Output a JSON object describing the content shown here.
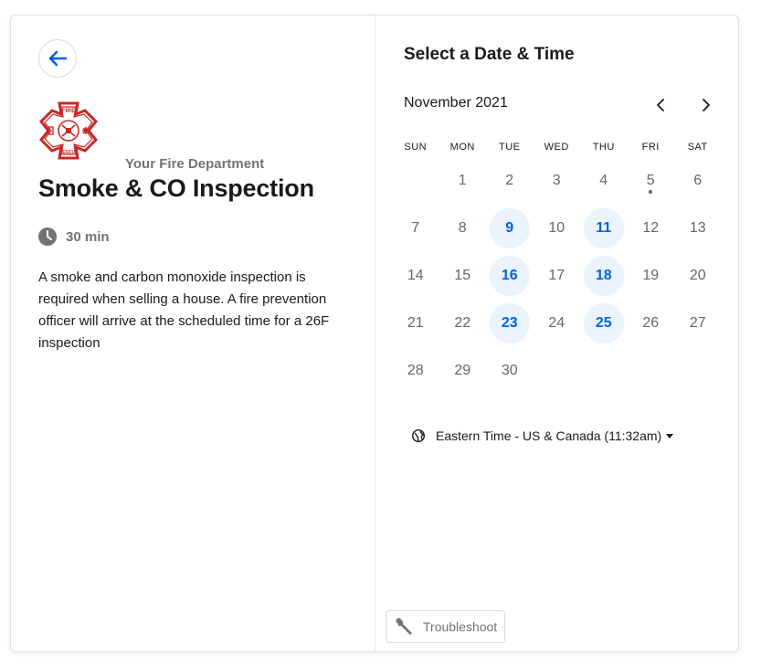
{
  "event": {
    "organization": "Your Fire Department",
    "title": "Smoke & CO Inspection",
    "duration": "30 min",
    "description": "A smoke and carbon monoxide inspection is required when selling a house. A fire prevention officer will arrive at the scheduled time for a 26F inspection",
    "logo": {
      "top_text": "FIRE",
      "bottom_text": "RESCUE",
      "color": "#c62828"
    }
  },
  "calendar": {
    "heading": "Select a Date & Time",
    "month": "November 2021",
    "weekdays": [
      "SUN",
      "MON",
      "TUE",
      "WED",
      "THU",
      "FRI",
      "SAT"
    ],
    "leading_blank_days": 1,
    "days": [
      {
        "n": "1"
      },
      {
        "n": "2"
      },
      {
        "n": "3"
      },
      {
        "n": "4"
      },
      {
        "n": "5",
        "today": true
      },
      {
        "n": "6"
      },
      {
        "n": "7"
      },
      {
        "n": "8"
      },
      {
        "n": "9",
        "available": true
      },
      {
        "n": "10"
      },
      {
        "n": "11",
        "available": true
      },
      {
        "n": "12"
      },
      {
        "n": "13"
      },
      {
        "n": "14"
      },
      {
        "n": "15"
      },
      {
        "n": "16",
        "available": true
      },
      {
        "n": "17"
      },
      {
        "n": "18",
        "available": true
      },
      {
        "n": "19"
      },
      {
        "n": "20"
      },
      {
        "n": "21"
      },
      {
        "n": "22"
      },
      {
        "n": "23",
        "available": true
      },
      {
        "n": "24"
      },
      {
        "n": "25",
        "available": true
      },
      {
        "n": "26"
      },
      {
        "n": "27"
      },
      {
        "n": "28"
      },
      {
        "n": "29"
      },
      {
        "n": "30"
      }
    ],
    "accent_color": "#0060e6",
    "available_bg": "#ebf3fd"
  },
  "timezone": {
    "label": "Eastern Time - US & Canada (11:32am)"
  },
  "troubleshoot": {
    "label": "Troubleshoot"
  },
  "icons": {
    "back": "arrow-left-icon",
    "clock": "clock-icon",
    "globe": "globe-icon",
    "wrench": "wrench-icon",
    "prev": "chevron-left-icon",
    "next": "chevron-right-icon"
  }
}
